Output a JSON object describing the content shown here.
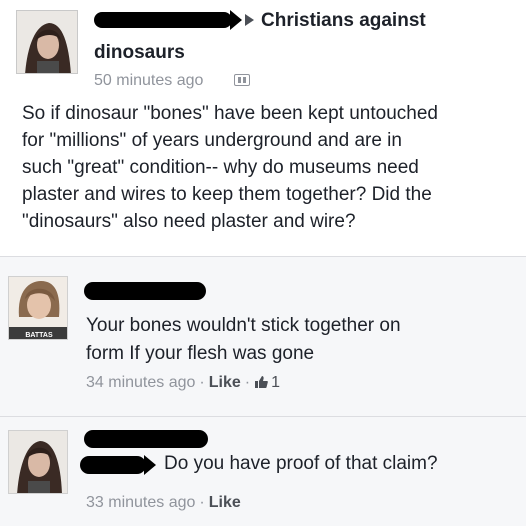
{
  "post": {
    "group_name_line1": "Christians against",
    "group_name_line2": "dinosaurs",
    "timestamp": "50 minutes ago",
    "body_lines": [
      "So if dinosaur \"bones\" have been kept untouched",
      "for \"millions\" of years underground and are in",
      "such \"great\" condition-- why do museums need",
      "plaster and wires to keep them together?  Did the",
      "\"dinosaurs\" also need plaster and wire?"
    ]
  },
  "comments": [
    {
      "avatar_caption": "BATTAS",
      "text_lines": [
        "Your bones wouldn't stick together on",
        "form If your flesh was gone"
      ],
      "timestamp": "34 minutes ago",
      "separator": "·",
      "like_label": "Like",
      "like_count": "1",
      "icons": [
        "thumbs-up-icon"
      ]
    },
    {
      "text_lines": [
        "Do you have proof of that claim?"
      ],
      "timestamp": "33 minutes ago",
      "separator": "·",
      "like_label": "Like"
    }
  ],
  "colors": {
    "text": "#1d2129",
    "meta": "#90949c",
    "redaction": "#000000",
    "comment_background": "#f6f7f9"
  },
  "icons": [
    "share-arrow-icon",
    "group-audience-icon",
    "thumbs-up-icon"
  ]
}
